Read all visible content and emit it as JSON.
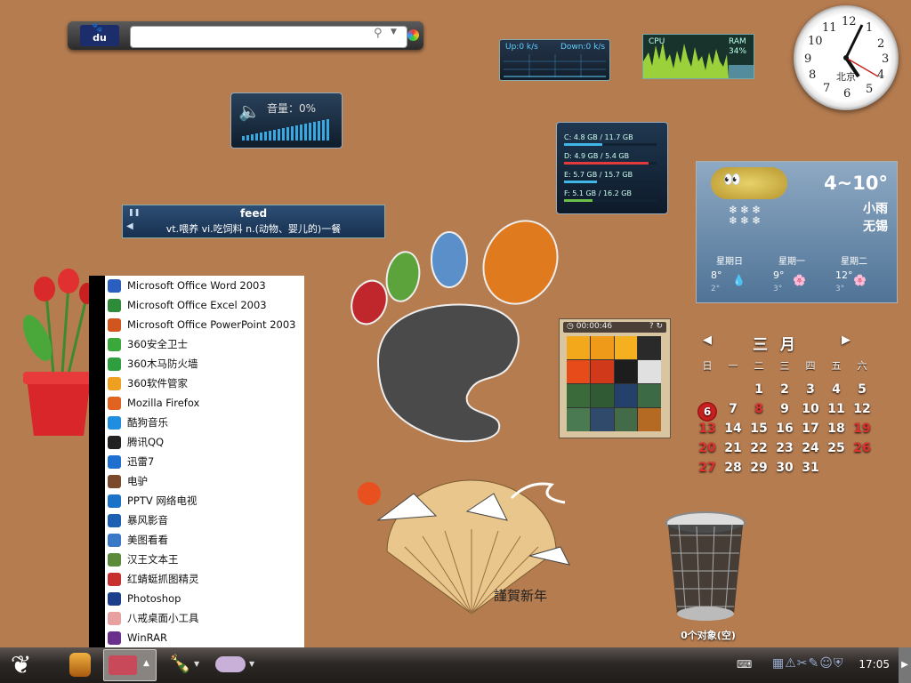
{
  "search": {
    "logo": "du",
    "placeholder": ""
  },
  "net_monitor": {
    "up": "Up:0 k/s",
    "down": "Down:0 k/s"
  },
  "cpu_monitor": {
    "cpu_label": "CPU",
    "ram_label": "RAM",
    "ram_value": "34%"
  },
  "volume": {
    "label": "音量：0%"
  },
  "disks": [
    {
      "label": "C: 4.8 GB / 11.7 GB",
      "fraction": 0.41,
      "color": "#3fb6e6"
    },
    {
      "label": "D: 4.9 GB / 5.4 GB",
      "fraction": 0.91,
      "color": "#e33b3b"
    },
    {
      "label": "E: 5.7 GB / 15.7 GB",
      "fraction": 0.36,
      "color": "#3fb6e6"
    },
    {
      "label": "F: 5.1 GB / 16.2 GB",
      "fraction": 0.31,
      "color": "#6cc04a"
    }
  ],
  "feed": {
    "word": "feed",
    "definition": "vt.喂养 vi.吃饲料 n.(动物、婴儿的)一餐"
  },
  "clock": {
    "city": "北京",
    "numbers": [
      "12",
      "1",
      "2",
      "3",
      "4",
      "5",
      "6",
      "7",
      "8",
      "9",
      "10",
      "11"
    ],
    "time": "17:05"
  },
  "weather": {
    "temp": "4~10°",
    "condition": "小雨",
    "city": "无锡",
    "forecast": [
      {
        "day": "星期日",
        "high": "8°",
        "low": "2°"
      },
      {
        "day": "星期一",
        "high": "9°",
        "low": "3°"
      },
      {
        "day": "星期二",
        "high": "12°",
        "low": "3°"
      }
    ]
  },
  "calendar": {
    "month": "三 月",
    "prev": "◀",
    "next": "▶",
    "weekdays": [
      "日",
      "一",
      "二",
      "三",
      "四",
      "五",
      "六"
    ],
    "first_weekday": 2,
    "days": 31,
    "today": 6,
    "red_days": [
      6,
      8,
      13,
      19,
      20,
      26,
      27
    ]
  },
  "puzzle": {
    "timer": "00:00:46"
  },
  "trash": {
    "label": "0个对象(空)"
  },
  "greeting": "謹賀新年",
  "start_menu": {
    "items": [
      {
        "label": "Microsoft Office Word 2003",
        "color": "#2b5fbf"
      },
      {
        "label": "Microsoft Office Excel 2003",
        "color": "#2e8b3a"
      },
      {
        "label": "Microsoft Office PowerPoint 2003",
        "color": "#d2551e"
      },
      {
        "label": "360安全卫士",
        "color": "#3aa83a"
      },
      {
        "label": "360木马防火墙",
        "color": "#2f9e3f"
      },
      {
        "label": "360软件管家",
        "color": "#f0a020"
      },
      {
        "label": "Mozilla Firefox",
        "color": "#e2631f"
      },
      {
        "label": "酷狗音乐",
        "color": "#1f8ee0"
      },
      {
        "label": "腾讯QQ",
        "color": "#222222"
      },
      {
        "label": "迅雷7",
        "color": "#1e6fd0"
      },
      {
        "label": "电驴",
        "color": "#7a4a2a"
      },
      {
        "label": "PPTV 网络电视",
        "color": "#1a73c8"
      },
      {
        "label": "暴风影音",
        "color": "#1d5fb0"
      },
      {
        "label": "美图看看",
        "color": "#3a78c8"
      },
      {
        "label": "汉王文本王",
        "color": "#5a8a3a"
      },
      {
        "label": "红蜻蜓抓图精灵",
        "color": "#c83030"
      },
      {
        "label": "Photoshop",
        "color": "#1b3f8a"
      },
      {
        "label": "八戒桌面小工具",
        "color": "#e8a0a0"
      },
      {
        "label": "WinRAR",
        "color": "#6a2f8a"
      }
    ]
  },
  "taskbar": {
    "time": "17:05"
  }
}
